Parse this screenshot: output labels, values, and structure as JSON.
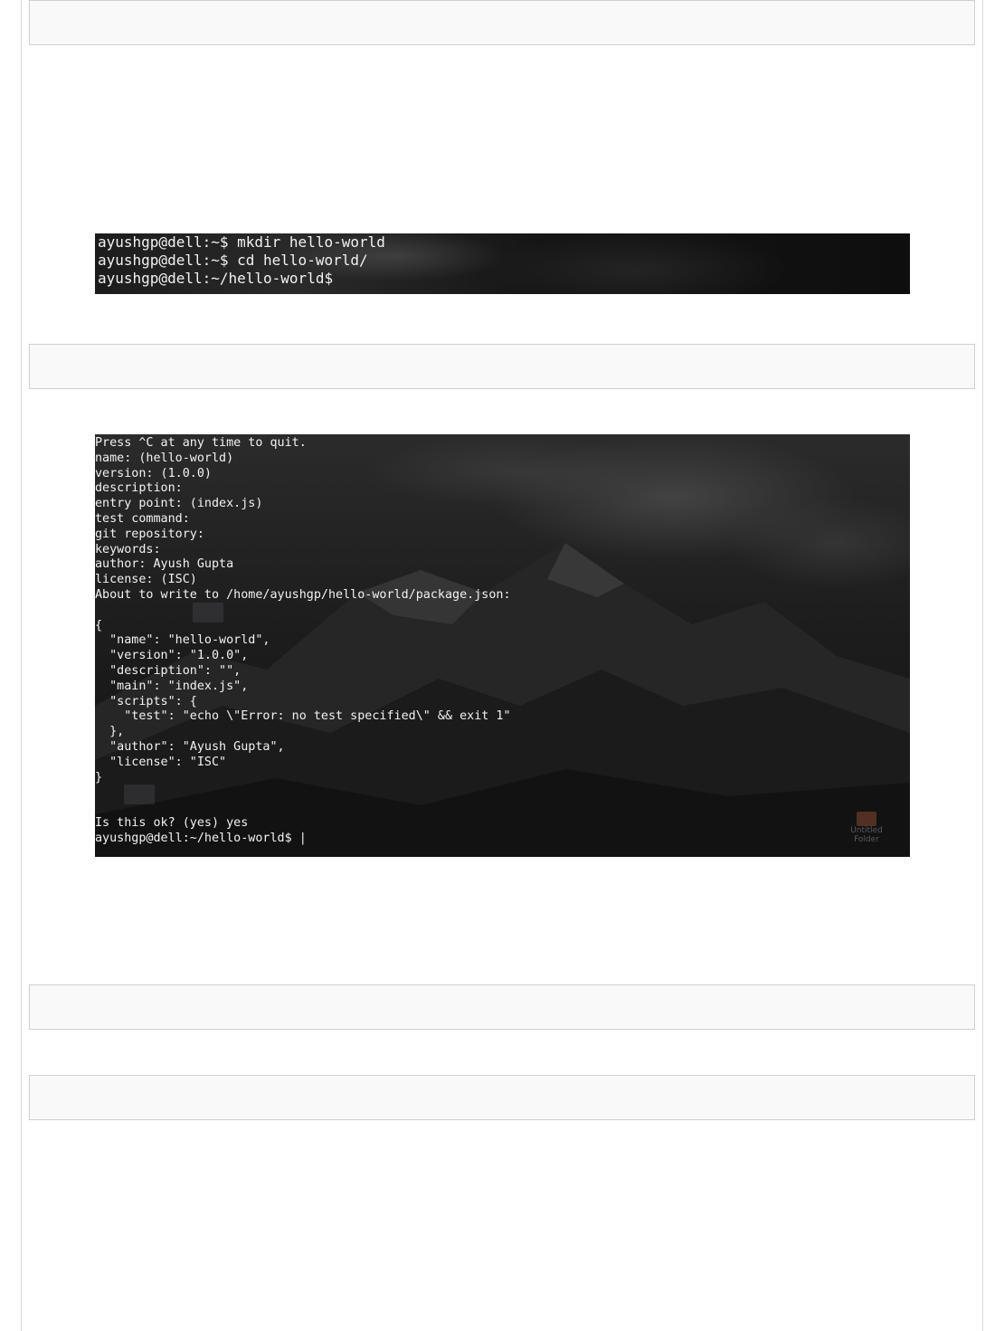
{
  "terminal_1": {
    "lines": [
      "ayushgp@dell:~$ mkdir hello-world",
      "ayushgp@dell:~$ cd hello-world/",
      "ayushgp@dell:~/hello-world$"
    ]
  },
  "terminal_2": {
    "lines": [
      "Press ^C at any time to quit.",
      "name: (hello-world)",
      "version: (1.0.0)",
      "description:",
      "entry point: (index.js)",
      "test command:",
      "git repository:",
      "keywords:",
      "author: Ayush Gupta",
      "license: (ISC)",
      "About to write to /home/ayushgp/hello-world/package.json:",
      "",
      "{",
      "  \"name\": \"hello-world\",",
      "  \"version\": \"1.0.0\",",
      "  \"description\": \"\",",
      "  \"main\": \"index.js\",",
      "  \"scripts\": {",
      "    \"test\": \"echo \\\"Error: no test specified\\\" && exit 1\"",
      "  },",
      "  \"author\": \"Ayush Gupta\",",
      "  \"license\": \"ISC\"",
      "}",
      "",
      "",
      "Is this ok? (yes) yes",
      "ayushgp@dell:~/hello-world$ |"
    ],
    "desktop_icon": {
      "icon": "folder-icon",
      "label_line1": "Untitled",
      "label_line2": "Folder"
    }
  },
  "code_boxes": [
    "",
    "",
    "",
    ""
  ]
}
